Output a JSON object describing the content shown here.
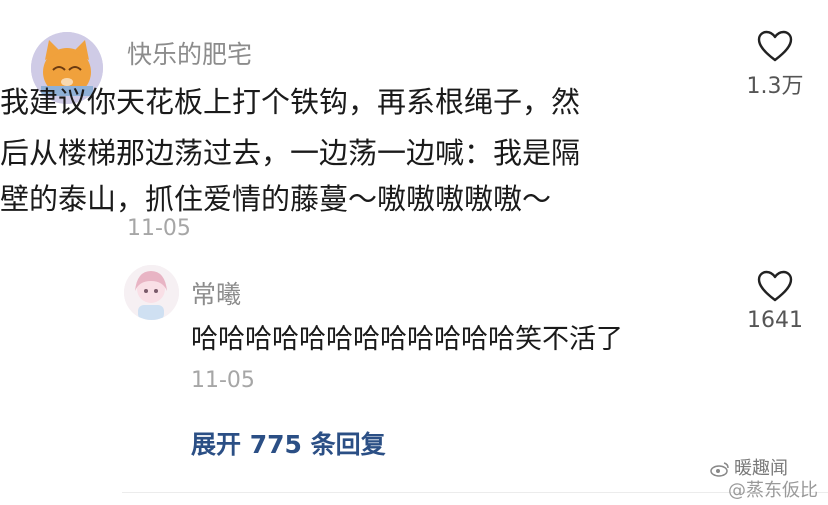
{
  "main_comment": {
    "username": "快乐的肥宅",
    "lines": [
      "我建议你天花板上打个铁钩，再系根绳子，然",
      "后从楼梯那边荡过去，一边荡一边喊：我是隔",
      "壁的泰山，抓住爱情的藤蔓～嗷嗷嗷嗷嗷～"
    ],
    "date": "11-05",
    "like_count": "1.3万",
    "avatar_icon": "cat-avatar-icon"
  },
  "reply": {
    "username": "常曦",
    "text": "哈哈哈哈哈哈哈哈哈哈哈哈笑不活了",
    "date": "11-05",
    "like_count": "1641",
    "avatar_icon": "girl-avatar-icon"
  },
  "expand_label": "展开 775 条回复",
  "watermark": {
    "brand": "暖趣闻",
    "sub": "@蒸东仮比"
  },
  "colors": {
    "username": "#8c8c8c",
    "date": "#a6a6a6",
    "link": "#2b4f85",
    "text": "#1a1a1a"
  }
}
